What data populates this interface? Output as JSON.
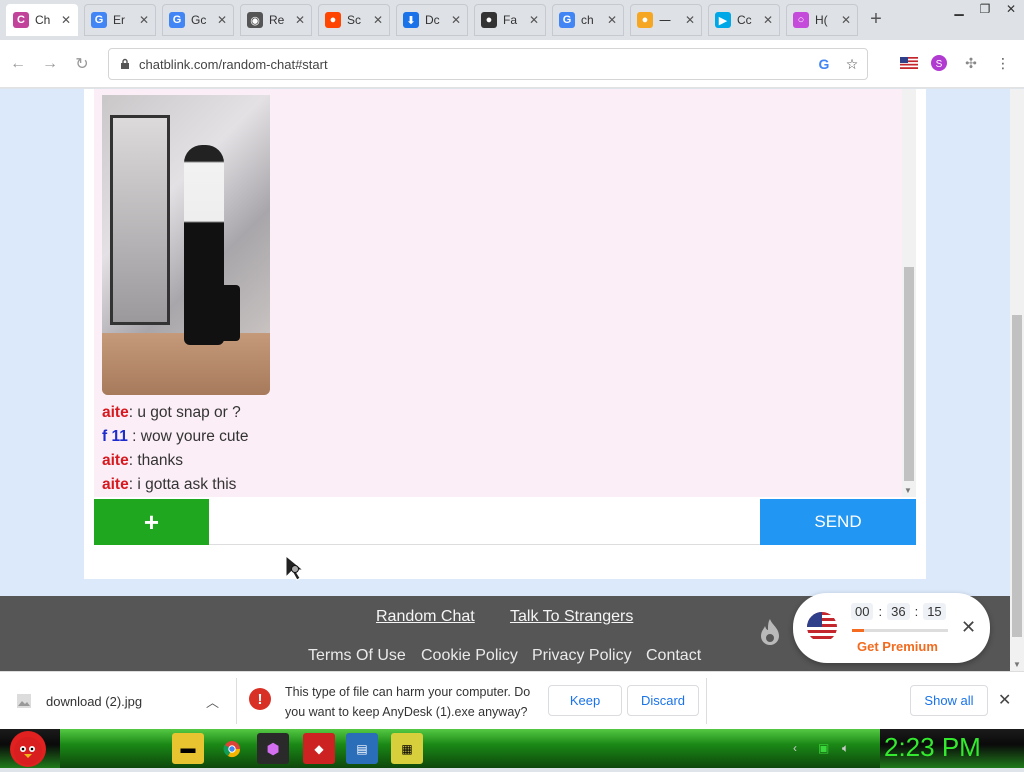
{
  "browser": {
    "tabs": [
      {
        "title": "Ch",
        "favicon_color": "#c1439a",
        "favicon_letter": "C",
        "active": true
      },
      {
        "title": "Er",
        "favicon_color": "#4285f4",
        "favicon_letter": "G"
      },
      {
        "title": "Gc",
        "favicon_color": "#4285f4",
        "favicon_letter": "G"
      },
      {
        "title": "Re",
        "favicon_color": "#555555",
        "favicon_letter": "◉"
      },
      {
        "title": "Sc",
        "favicon_color": "#ff4500",
        "favicon_letter": "●"
      },
      {
        "title": "Dc",
        "favicon_color": "#1a73e8",
        "favicon_letter": "⬇"
      },
      {
        "title": "Fa",
        "favicon_color": "#333333",
        "favicon_letter": "●"
      },
      {
        "title": "ch",
        "favicon_color": "#4285f4",
        "favicon_letter": "G"
      },
      {
        "title": "一",
        "favicon_color": "#f5a623",
        "favicon_letter": "●"
      },
      {
        "title": "Cc",
        "favicon_color": "#00a8e8",
        "favicon_letter": "▶"
      },
      {
        "title": "H(",
        "favicon_color": "#c54bdb",
        "favicon_letter": "○"
      }
    ],
    "url": "chatblink.com/random-chat#start"
  },
  "chat": {
    "messages": [
      {
        "author": "aite",
        "text": ": u got snap or ?",
        "color": "red"
      },
      {
        "author": "f 11",
        "text": " : wow youre cute",
        "color": "blue"
      },
      {
        "author": "aite",
        "text": ": thanks",
        "color": "red"
      },
      {
        "author": "aite",
        "text": ": i gotta ask this",
        "color": "red"
      }
    ],
    "plus_label": "+",
    "input_placeholder": "",
    "send_label": "SEND"
  },
  "footer": {
    "link_random_chat": "Random Chat",
    "link_talk_to_strangers": "Talk To Strangers",
    "link_terms": "Terms Of Use",
    "link_cookie": "Cookie Policy",
    "link_privacy": "Privacy Policy",
    "link_contact": "Contact"
  },
  "timer": {
    "hours": "00",
    "minutes": "36",
    "seconds": "15",
    "progress": 0.12,
    "premium_label": "Get Premium"
  },
  "downloads": {
    "file_name": "download (2).jpg",
    "warning_text": "This type of file can harm your computer. Do you want to keep AnyDesk (1).exe anyway?",
    "keep_label": "Keep",
    "discard_label": "Discard",
    "show_all_label": "Show all"
  },
  "taskbar": {
    "clock": "2:23 PM"
  }
}
